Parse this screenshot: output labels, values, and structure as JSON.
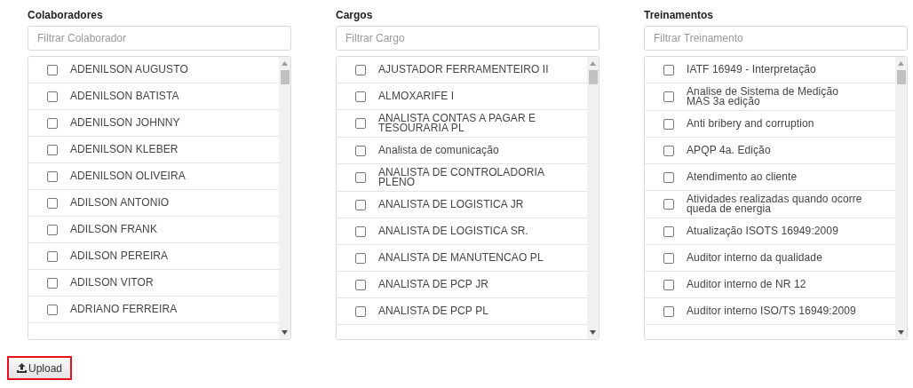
{
  "panels": [
    {
      "title": "Colaboradores",
      "filter": {
        "placeholder": "Filtrar Colaborador"
      },
      "items": [
        {
          "label": "ADENILSON AUGUSTO",
          "checked": false
        },
        {
          "label": "ADENILSON BATISTA",
          "checked": false
        },
        {
          "label": "ADENILSON JOHNNY",
          "checked": false
        },
        {
          "label": "ADENILSON KLEBER",
          "checked": false
        },
        {
          "label": "ADENILSON OLIVEIRA",
          "checked": false
        },
        {
          "label": "ADILSON ANTONIO",
          "checked": false
        },
        {
          "label": "ADILSON FRANK",
          "checked": false
        },
        {
          "label": "ADILSON PEREIRA",
          "checked": false
        },
        {
          "label": "ADILSON VITOR",
          "checked": false
        },
        {
          "label": "ADRIANO FERREIRA",
          "checked": false
        }
      ]
    },
    {
      "title": "Cargos",
      "filter": {
        "placeholder": "Filtrar Cargo"
      },
      "items": [
        {
          "label": "AJUSTADOR FERRAMENTEIRO II",
          "checked": false
        },
        {
          "label": "ALMOXARIFE I",
          "checked": false
        },
        {
          "label": "ANALISTA CONTAS A PAGAR E TESOURARIA PL",
          "checked": false
        },
        {
          "label": "Analista de comunicação",
          "checked": false
        },
        {
          "label": "ANALISTA DE CONTROLADORIA PLENO",
          "checked": false
        },
        {
          "label": "ANALISTA DE LOGISTICA JR",
          "checked": false
        },
        {
          "label": "ANALISTA DE LOGISTICA SR.",
          "checked": false
        },
        {
          "label": "ANALISTA DE MANUTENCAO PL",
          "checked": false
        },
        {
          "label": "ANALISTA DE PCP JR",
          "checked": false
        },
        {
          "label": "ANALISTA DE PCP PL",
          "checked": false
        }
      ]
    },
    {
      "title": "Treinamentos",
      "filter": {
        "placeholder": "Filtrar Treinamento"
      },
      "items": [
        {
          "label": "IATF 16949 - Interpretação",
          "checked": false
        },
        {
          "label": "Analise de Sistema de Medição MAS 3a edição",
          "checked": false
        },
        {
          "label": "Anti bribery and corruption",
          "checked": false
        },
        {
          "label": "APQP 4a. Edição",
          "checked": false
        },
        {
          "label": "Atendimento ao cliente",
          "checked": false
        },
        {
          "label": "Atividades realizadas quando ocorre queda de energia",
          "checked": false
        },
        {
          "label": "Atualização ISOTS 16949:2009",
          "checked": false
        },
        {
          "label": "Auditor interno da qualidade",
          "checked": false
        },
        {
          "label": "Auditor interno de NR 12",
          "checked": false
        },
        {
          "label": "Auditor interno ISO/TS 16949:2009",
          "checked": false
        }
      ]
    }
  ],
  "upload_button": {
    "label": "Upload"
  }
}
